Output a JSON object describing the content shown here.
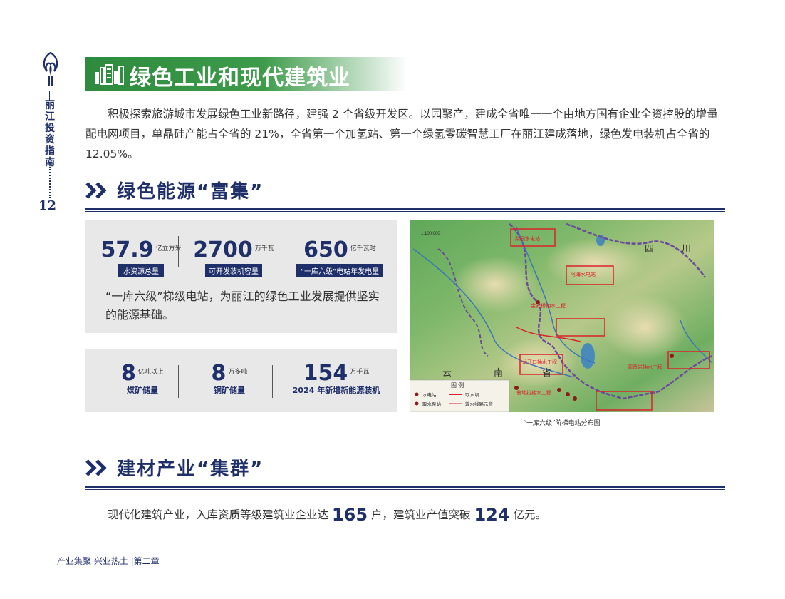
{
  "rail": {
    "vertical_title": "丽江投资指南",
    "page_number": "12"
  },
  "banner": {
    "title": "绿色工业和现代建筑业"
  },
  "intro": "积极探索旅游城市发展绿色工业新路径，建强 2 个省级开发区。以园聚产，建成全省唯一一个由地方国有企业全资控股的增量配电网项目，单晶硅产能占全省的 21%，全省第一个加氢站、第一个绿氢零碳智慧工厂在丽江建成落地，绿色发电装机占全省的 12.05%。",
  "section1": {
    "title": "绿色能源“富集”"
  },
  "stats_top": [
    {
      "value": "57.9",
      "unit": "亿立方米",
      "label": "水资源总量"
    },
    {
      "value": "2700",
      "unit": "万千瓦",
      "label": "可开发装机容量"
    },
    {
      "value": "650",
      "unit": "亿千瓦时",
      "label": "“一库六级”电站年发电量"
    }
  ],
  "panel_quote": "“一库六级”梯级电站，为丽江的绿色工业发展提供坚实的能源基础。",
  "stats_bottom": [
    {
      "value": "8",
      "unit": "亿吨以上",
      "label": "煤矿储量"
    },
    {
      "value": "8",
      "unit": "万多吨",
      "label": "铜矿储量"
    },
    {
      "value": "154",
      "unit": "万千瓦",
      "label": "2024 年新增新能源装机"
    }
  ],
  "map": {
    "scale": "1:100 000",
    "caption": "“一库六级”阶梯电站分布图",
    "legend_title": "图 例",
    "legend": [
      "水电站",
      "取水坝",
      "取水泵站",
      "输水线路示意"
    ],
    "region_labels": [
      "四",
      "川",
      "云",
      "南",
      "省"
    ],
    "stations": [
      "金安桥抽水工程",
      "龙开口抽水工程",
      "鲁地拉抽水工程",
      "观音岩抽水工程",
      "梨园水电站",
      "阿海水电站"
    ],
    "colors": {
      "box": "#d8232a",
      "river": "#6b4a9a"
    }
  },
  "section2": {
    "title": "建材产业“集群”"
  },
  "para2": {
    "pre": "现代化建筑产业，入库资质等级建筑业企业达",
    "n1": "165",
    "mid": "户，建筑业产值突破",
    "n2": "124",
    "post": "亿元。"
  },
  "footer": "产业集聚  兴业热土 |第二章"
}
